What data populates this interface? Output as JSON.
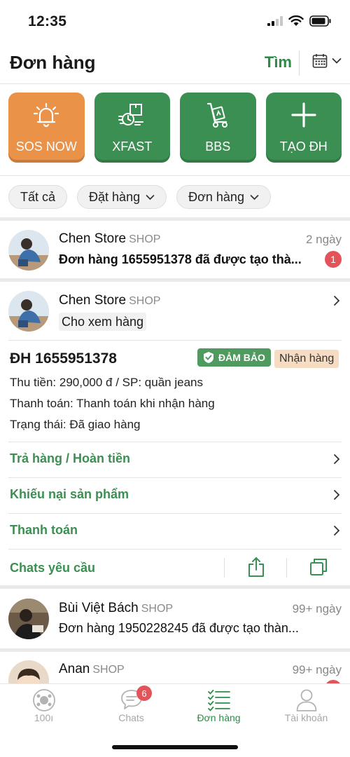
{
  "status_bar": {
    "time": "12:35"
  },
  "header": {
    "title": "Đơn hàng",
    "search_label": "Tìm"
  },
  "actions": [
    {
      "label": "SOS NOW",
      "icon": "alarm-bell-icon",
      "color": "#ea9248"
    },
    {
      "label": "XFAST",
      "icon": "fast-delivery-icon",
      "color": "#3c8f53"
    },
    {
      "label": "BBS",
      "icon": "hand-truck-icon",
      "color": "#3c8f53"
    },
    {
      "label": "TẠO ĐH",
      "icon": "plus-icon",
      "color": "#3c8f53"
    }
  ],
  "filters": [
    {
      "label": "Tất cả",
      "dropdown": false
    },
    {
      "label": "Đặt hàng",
      "dropdown": true
    },
    {
      "label": "Đơn hàng",
      "dropdown": true
    }
  ],
  "conversations": [
    {
      "name": "Chen Store",
      "tag": "SHOP",
      "time": "2 ngày",
      "preview": "Đơn hàng 1655951378 đã được tạo thà...",
      "unread": "1"
    },
    {
      "name": "Bùi Việt Bách",
      "tag": "SHOP",
      "time": "99+ ngày",
      "preview": "Đơn hàng 1950228245 đã được tạo thàn..."
    },
    {
      "name": "Anan",
      "tag": "SHOP",
      "time": "99+ ngày"
    }
  ],
  "order_card": {
    "shop_name": "Chen Store",
    "shop_tag": "SHOP",
    "sample_label": "Cho xem hàng",
    "order_id": "ĐH 1655951378",
    "guarantee_badge": "ĐẢM BẢO",
    "status_badge": "Nhận hàng",
    "collect_line": "Thu tiền: 290,000 đ / SP: quần jeans",
    "payment_line": "Thanh toán: Thanh toán khi nhận hàng",
    "state_line": "Trạng thái: Đã giao hàng",
    "actions": [
      {
        "label": "Trả hàng / Hoàn tiền"
      },
      {
        "label": "Khiếu nại sản phẩm"
      },
      {
        "label": "Thanh toán"
      }
    ],
    "chat_request_label": "Chats yêu cầu"
  },
  "tabbar": [
    {
      "label": "100ı",
      "icon": "network-hub-icon"
    },
    {
      "label": "Chats",
      "icon": "chat-bubble-icon",
      "badge": "6"
    },
    {
      "label": "Đơn hàng",
      "icon": "order-checklist-icon",
      "active": true
    },
    {
      "label": "Tài khoản",
      "icon": "user-account-icon"
    }
  ],
  "colors": {
    "brand_green": "#3c8f53",
    "sos_orange": "#ea9248",
    "badge_red": "#e2545a"
  }
}
